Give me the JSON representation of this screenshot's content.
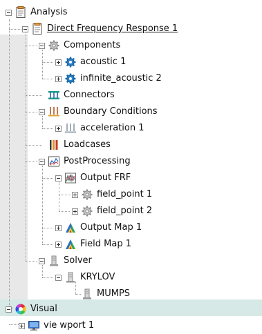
{
  "tree": {
    "analysis": {
      "label": "Analysis"
    },
    "direct_frequency_response": {
      "label": "Direct Frequency Response 1"
    },
    "components": {
      "label": "Components"
    },
    "acoustic": {
      "label": "acoustic 1"
    },
    "infinite_acoustic": {
      "label": "infinite_acoustic 2"
    },
    "connectors": {
      "label": "Connectors"
    },
    "boundary_conditions": {
      "label": "Boundary Conditions"
    },
    "acceleration": {
      "label": "acceleration 1"
    },
    "loadcases": {
      "label": "Loadcases"
    },
    "postprocessing": {
      "label": "PostProcessing"
    },
    "output_frf": {
      "label": "Output FRF"
    },
    "field_point_1": {
      "label": "field_point 1"
    },
    "field_point_2": {
      "label": "field_point 2"
    },
    "output_map": {
      "label": "Output Map 1"
    },
    "field_map": {
      "label": "Field Map 1"
    },
    "solver": {
      "label": "Solver"
    },
    "krylov": {
      "label": "KRYLOV"
    },
    "mumps": {
      "label": "MUMPS"
    },
    "visual": {
      "label": "Visual"
    },
    "viewport": {
      "label": "vie wport 1"
    }
  },
  "colors": {
    "band_gray": "#e8e8e8",
    "visual_band": "#d7e9e6",
    "gear_blue": "#1f6fb5",
    "gear_gray": "#9a9a9a"
  },
  "icons": [
    "document-icon",
    "gear-icon",
    "blue-gear-icon",
    "connector-icon",
    "boundary-condition-icon",
    "loadcase-icon",
    "chart-icon",
    "frf-icon",
    "colormap-icon",
    "solver-icon",
    "color-wheel-icon",
    "monitor-icon"
  ]
}
